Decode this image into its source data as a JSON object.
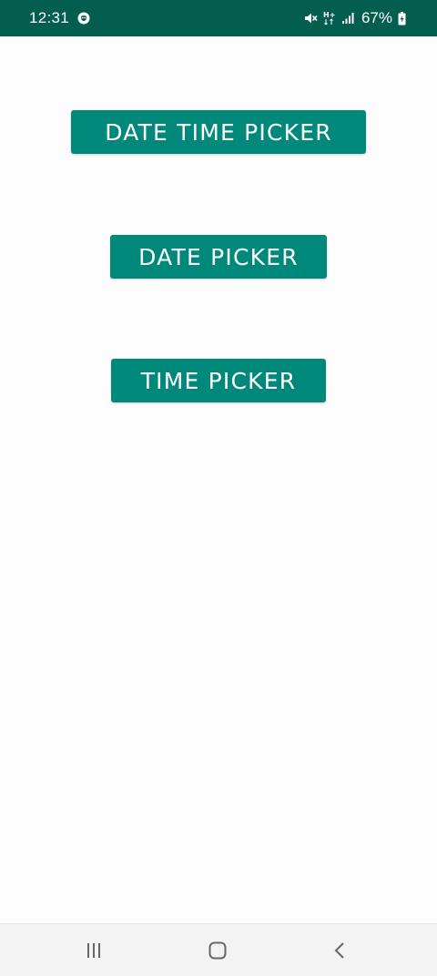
{
  "status_bar": {
    "time": "12:31",
    "battery": "67%",
    "icons": [
      "shield-icon",
      "mute-icon",
      "hplus-signal-icon",
      "signal-bars-icon",
      "battery-charging-icon"
    ],
    "background_color": "#045e50"
  },
  "buttons": {
    "datetime_label": "DATE TIME PICKER",
    "date_label": "DATE PICKER",
    "time_label": "TIME PICKER",
    "color": "#00897b"
  },
  "nav_bar": {
    "icons": [
      "recents-icon",
      "home-icon",
      "back-icon"
    ]
  }
}
